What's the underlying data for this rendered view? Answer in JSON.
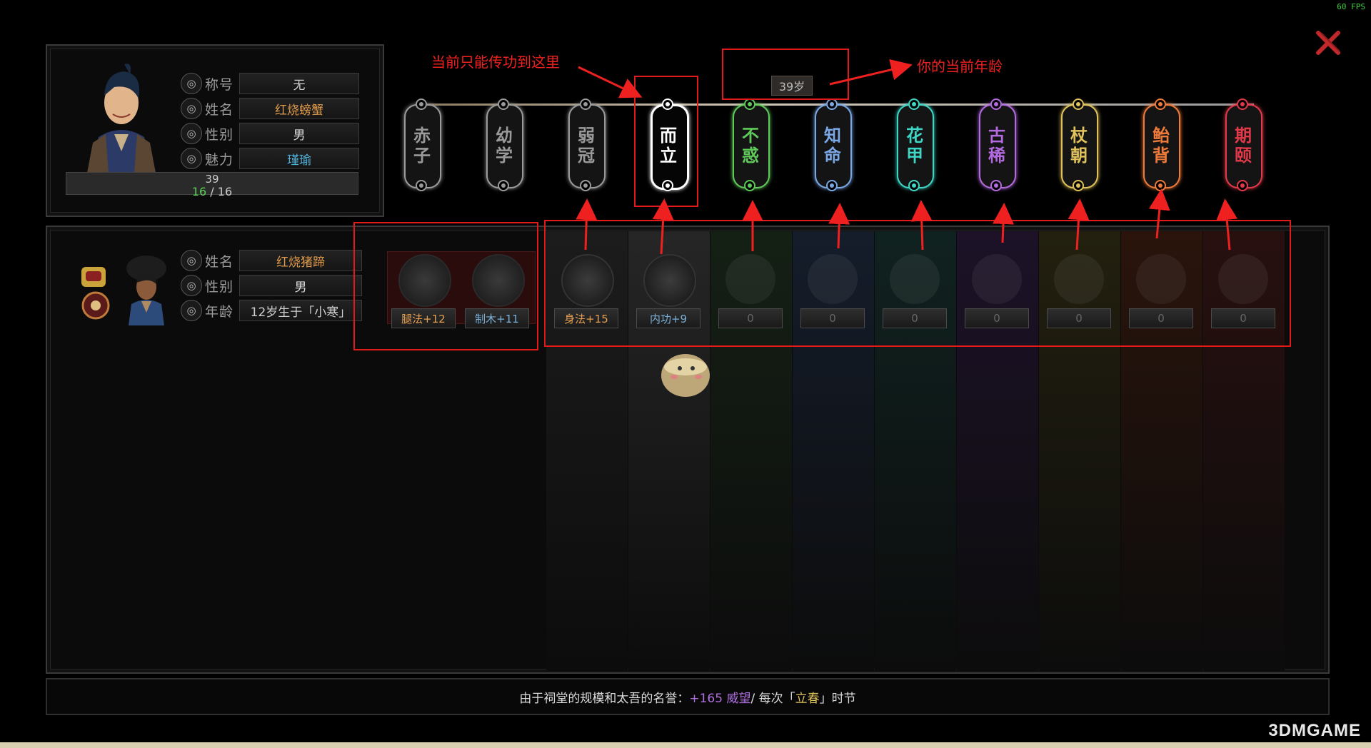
{
  "fps": "60 FPS",
  "character": {
    "rows": [
      {
        "icon": "title-icon",
        "label": "称号",
        "value": "无",
        "color": "#cfcfcf"
      },
      {
        "icon": "name-icon",
        "label": "姓名",
        "value": "红烧螃蟹",
        "color": "#e09a4a"
      },
      {
        "icon": "gender-icon",
        "label": "性别",
        "value": "男",
        "color": "#dddddd"
      },
      {
        "icon": "charm-icon",
        "label": "魅力",
        "value": "瑾瑜",
        "color": "#4fb0d8"
      }
    ],
    "age_value": "39",
    "progress_current": "16",
    "progress_sep": "/",
    "progress_max": "16"
  },
  "timeline": {
    "current_age": "39岁",
    "stages": [
      {
        "id": "chizi",
        "label": "赤子",
        "color": "#9a9a9a",
        "active": false
      },
      {
        "id": "youxue",
        "label": "幼学",
        "color": "#9a9a9a",
        "active": false
      },
      {
        "id": "ruoguan",
        "label": "弱冠",
        "color": "#9a9a9a",
        "active": false
      },
      {
        "id": "erli",
        "label": "而立",
        "color": "#ffffff",
        "active": true
      },
      {
        "id": "buhuo",
        "label": "不惑",
        "color": "#5fc95a",
        "active": false
      },
      {
        "id": "zhiming",
        "label": "知命",
        "color": "#7aa8e6",
        "active": false
      },
      {
        "id": "huajia",
        "label": "花甲",
        "color": "#3fd6c6",
        "active": false
      },
      {
        "id": "guxi",
        "label": "古稀",
        "color": "#b46ae0",
        "active": false
      },
      {
        "id": "zhangchao",
        "label": "杖朝",
        "color": "#e0c25a",
        "active": false
      },
      {
        "id": "taibei",
        "label": "鲐背",
        "color": "#ee7a3a",
        "active": false
      },
      {
        "id": "qiyi",
        "label": "期颐",
        "color": "#e03a4a",
        "active": false
      }
    ]
  },
  "heir": {
    "rows": [
      {
        "icon": "name-icon",
        "label": "姓名",
        "value": "红烧猪蹄",
        "color": "#e09a4a"
      },
      {
        "icon": "gender-icon",
        "label": "性别",
        "value": "男",
        "color": "#dddddd"
      },
      {
        "icon": "age-icon",
        "label": "年龄",
        "value": "12岁生于「小寒」",
        "color": "#cfcfcf"
      }
    ],
    "skills": [
      {
        "name": "腿法+12",
        "color": "#e8a050"
      },
      {
        "name": "制木+11",
        "color": "#7ab0d8"
      }
    ]
  },
  "slots": [
    {
      "label": "身法+15",
      "color": "#e8a050",
      "filled": true
    },
    {
      "label": "内功+9",
      "color": "#7ab0d8",
      "filled": true
    },
    {
      "label": "0",
      "color": "#666666",
      "filled": false
    },
    {
      "label": "0",
      "color": "#666666",
      "filled": false
    },
    {
      "label": "0",
      "color": "#666666",
      "filled": false
    },
    {
      "label": "0",
      "color": "#666666",
      "filled": false
    },
    {
      "label": "0",
      "color": "#666666",
      "filled": false
    },
    {
      "label": "0",
      "color": "#666666",
      "filled": false
    },
    {
      "label": "0",
      "color": "#666666",
      "filled": false
    }
  ],
  "annotations": {
    "limit": "当前只能传功到这里",
    "age": "你的当前年龄"
  },
  "footer": {
    "prefix": "由于祠堂的规模和太吾的名誉：",
    "value": "+165 威望",
    "mid": " / 每次「",
    "season": "立春",
    "suffix": "」时节"
  },
  "watermark": "3DMGAME"
}
